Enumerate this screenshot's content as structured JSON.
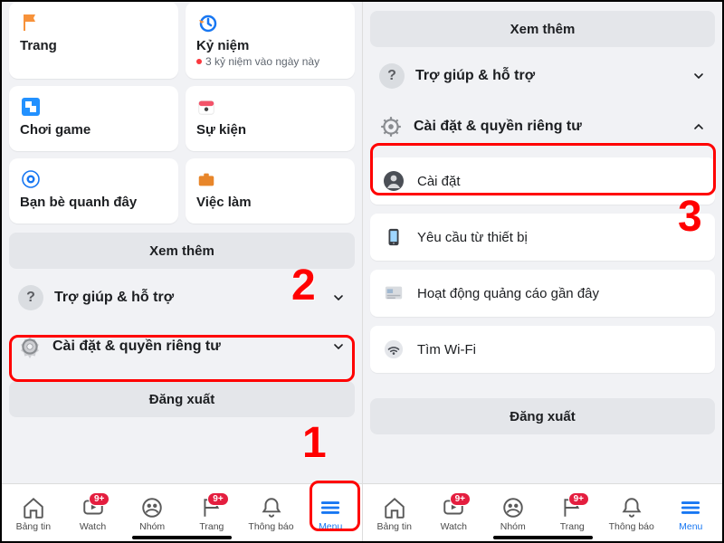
{
  "left": {
    "tiles": {
      "trang": "Trang",
      "kyniem": "Kỷ niệm",
      "kyniem_sub": "3 kỷ niệm vào ngày này",
      "choigame": "Chơi game",
      "sukien": "Sự kiện",
      "banbe": "Bạn bè quanh đây",
      "vieclam": "Việc làm"
    },
    "see_more": "Xem thêm",
    "help": "Trợ giúp & hỗ trợ",
    "settings_privacy": "Cài đặt & quyền riêng tư",
    "logout": "Đăng xuất"
  },
  "right": {
    "see_more": "Xem thêm",
    "help": "Trợ giúp & hỗ trợ",
    "settings_privacy": "Cài đặt & quyền riêng tư",
    "items": {
      "settings": "Cài đặt",
      "device_requests": "Yêu cầu từ thiết bị",
      "recent_ads": "Hoạt động quảng cáo gần đây",
      "find_wifi": "Tìm Wi-Fi"
    },
    "logout": "Đăng xuất"
  },
  "tabs": {
    "feed": "Bảng tin",
    "watch": "Watch",
    "groups": "Nhóm",
    "pages": "Trang",
    "notifications": "Thông báo",
    "menu": "Menu",
    "badge": "9+"
  },
  "callouts": {
    "n1": "1",
    "n2": "2",
    "n3": "3"
  }
}
